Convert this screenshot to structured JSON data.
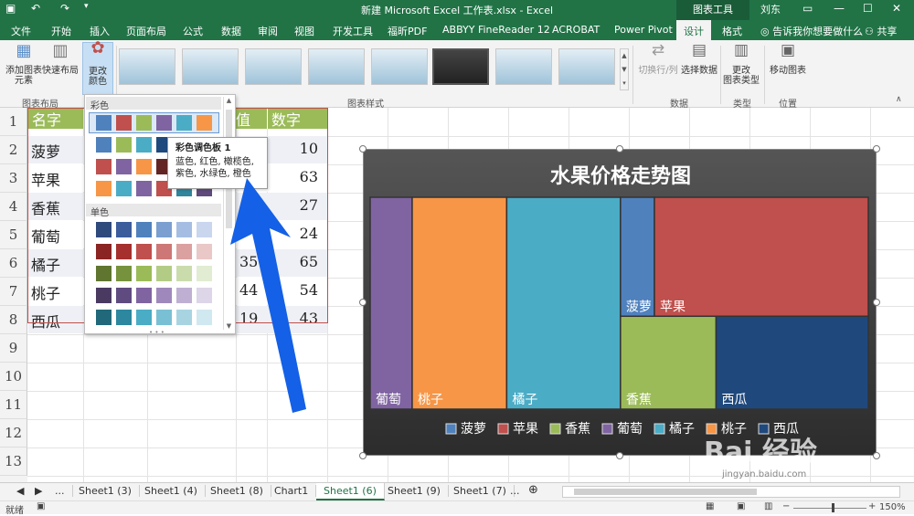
{
  "titlebar": {
    "title": "新建 Microsoft Excel 工作表.xlsx  -  Excel",
    "chart_tools": "图表工具",
    "user": "刘东",
    "undo_icon": "undo-icon",
    "redo_icon": "redo-icon"
  },
  "tabs": [
    "文件",
    "开始",
    "插入",
    "页面布局",
    "公式",
    "数据",
    "审阅",
    "视图",
    "开发工具",
    "福昕PDF",
    "ABBYY FineReader 12",
    "ACROBAT",
    "Power Pivot",
    "设计",
    "格式"
  ],
  "tell_me": "告诉我你想要做什么",
  "share": "共享",
  "ribbon": {
    "add_element": "添加图表\n元素",
    "quick_layout": "快速布局",
    "change_colors": "更改\n颜色",
    "group_layout": "图表布局",
    "group_styles": "图表样式",
    "switch_row_col": "切换行/列",
    "select_data": "选择数据",
    "group_data": "数据",
    "change_type": "更改\n图表类型",
    "group_type": "类型",
    "move_chart": "移动图表",
    "group_location": "位置"
  },
  "palette": {
    "colorful_label": "彩色",
    "mono_label": "单色",
    "tooltip_title": "彩色调色板 1",
    "tooltip_desc": "蓝色, 红色, 橄榄色, 紫色, 水绿色, 橙色",
    "colorful_rows": [
      [
        "#4f81bd",
        "#c0504d",
        "#9bbb59",
        "#8064a2",
        "#4bacc6",
        "#f79646"
      ],
      [
        "#4f81bd",
        "#9bbb59",
        "#4bacc6",
        "#1f497d",
        "#c0504d",
        "#8064a2"
      ],
      [
        "#c0504d",
        "#8064a2",
        "#f79646",
        "#632523",
        "#4bacc6",
        "#4f81bd"
      ],
      [
        "#f79646",
        "#4bacc6",
        "#8064a2",
        "#c0504d",
        "#31859c",
        "#604a7b"
      ]
    ],
    "mono_rows": [
      [
        "#2e4a7d",
        "#3b5d9c",
        "#4f81bd",
        "#7b9fd0",
        "#a6bde3",
        "#c9d6ee"
      ],
      [
        "#8b2523",
        "#a5302d",
        "#c0504d",
        "#cd7876",
        "#dba1a0",
        "#e9c8c7"
      ],
      [
        "#5f7530",
        "#76923c",
        "#9bbb59",
        "#b3cc85",
        "#cbdcac",
        "#e1ecd2"
      ],
      [
        "#4a3a62",
        "#5f4b80",
        "#8064a2",
        "#9f89bc",
        "#bfb0d3",
        "#ddd5e8"
      ],
      [
        "#21687a",
        "#2c879f",
        "#4bacc6",
        "#7ac0d4",
        "#a8d4e2",
        "#d0e8f0"
      ]
    ]
  },
  "sheet": {
    "header_name": "名字",
    "header_num": "数字",
    "header_mid": "值",
    "rows": [
      {
        "name": "菠萝",
        "num": "10"
      },
      {
        "name": "苹果",
        "num": "63"
      },
      {
        "name": "香蕉",
        "num": "27"
      },
      {
        "name": "葡萄",
        "num": "24"
      },
      {
        "name": "橘子",
        "mid": "35",
        "num": "65"
      },
      {
        "name": "桃子",
        "mid": "44",
        "num": "54"
      },
      {
        "name": "西瓜",
        "mid": "19",
        "num": "43"
      }
    ],
    "row_numbers": [
      "1",
      "2",
      "3",
      "4",
      "5",
      "6",
      "7",
      "8",
      "9",
      "10",
      "11",
      "12",
      "13"
    ]
  },
  "chart_data": {
    "type": "treemap",
    "title": "水果价格走势图",
    "categories": [
      "葡萄",
      "桃子",
      "橘子",
      "菠萝",
      "苹果",
      "香蕉",
      "西瓜"
    ],
    "values": [
      24,
      54,
      65,
      10,
      63,
      27,
      43
    ],
    "colors": {
      "菠萝": "#4f81bd",
      "苹果": "#c0504d",
      "香蕉": "#9bbb59",
      "葡萄": "#8064a2",
      "橘子": "#4bacc6",
      "桃子": "#f79646",
      "西瓜": "#1f497d"
    },
    "legend": [
      "菠萝",
      "苹果",
      "香蕉",
      "葡萄",
      "橘子",
      "桃子",
      "西瓜"
    ],
    "legend_position": "bottom"
  },
  "sheet_tabs": [
    "...",
    "Sheet1 (3)",
    "Sheet1 (4)",
    "Sheet1 (8)",
    "Chart1",
    "Sheet1 (6)",
    "Sheet1 (9)",
    "Sheet1 (7)",
    "..."
  ],
  "active_tab": "Sheet1 (6)",
  "status": {
    "ready": "就绪",
    "zoom": "150%"
  },
  "watermark": "Bai 经验",
  "watermark_url": "jingyan.baidu.com"
}
